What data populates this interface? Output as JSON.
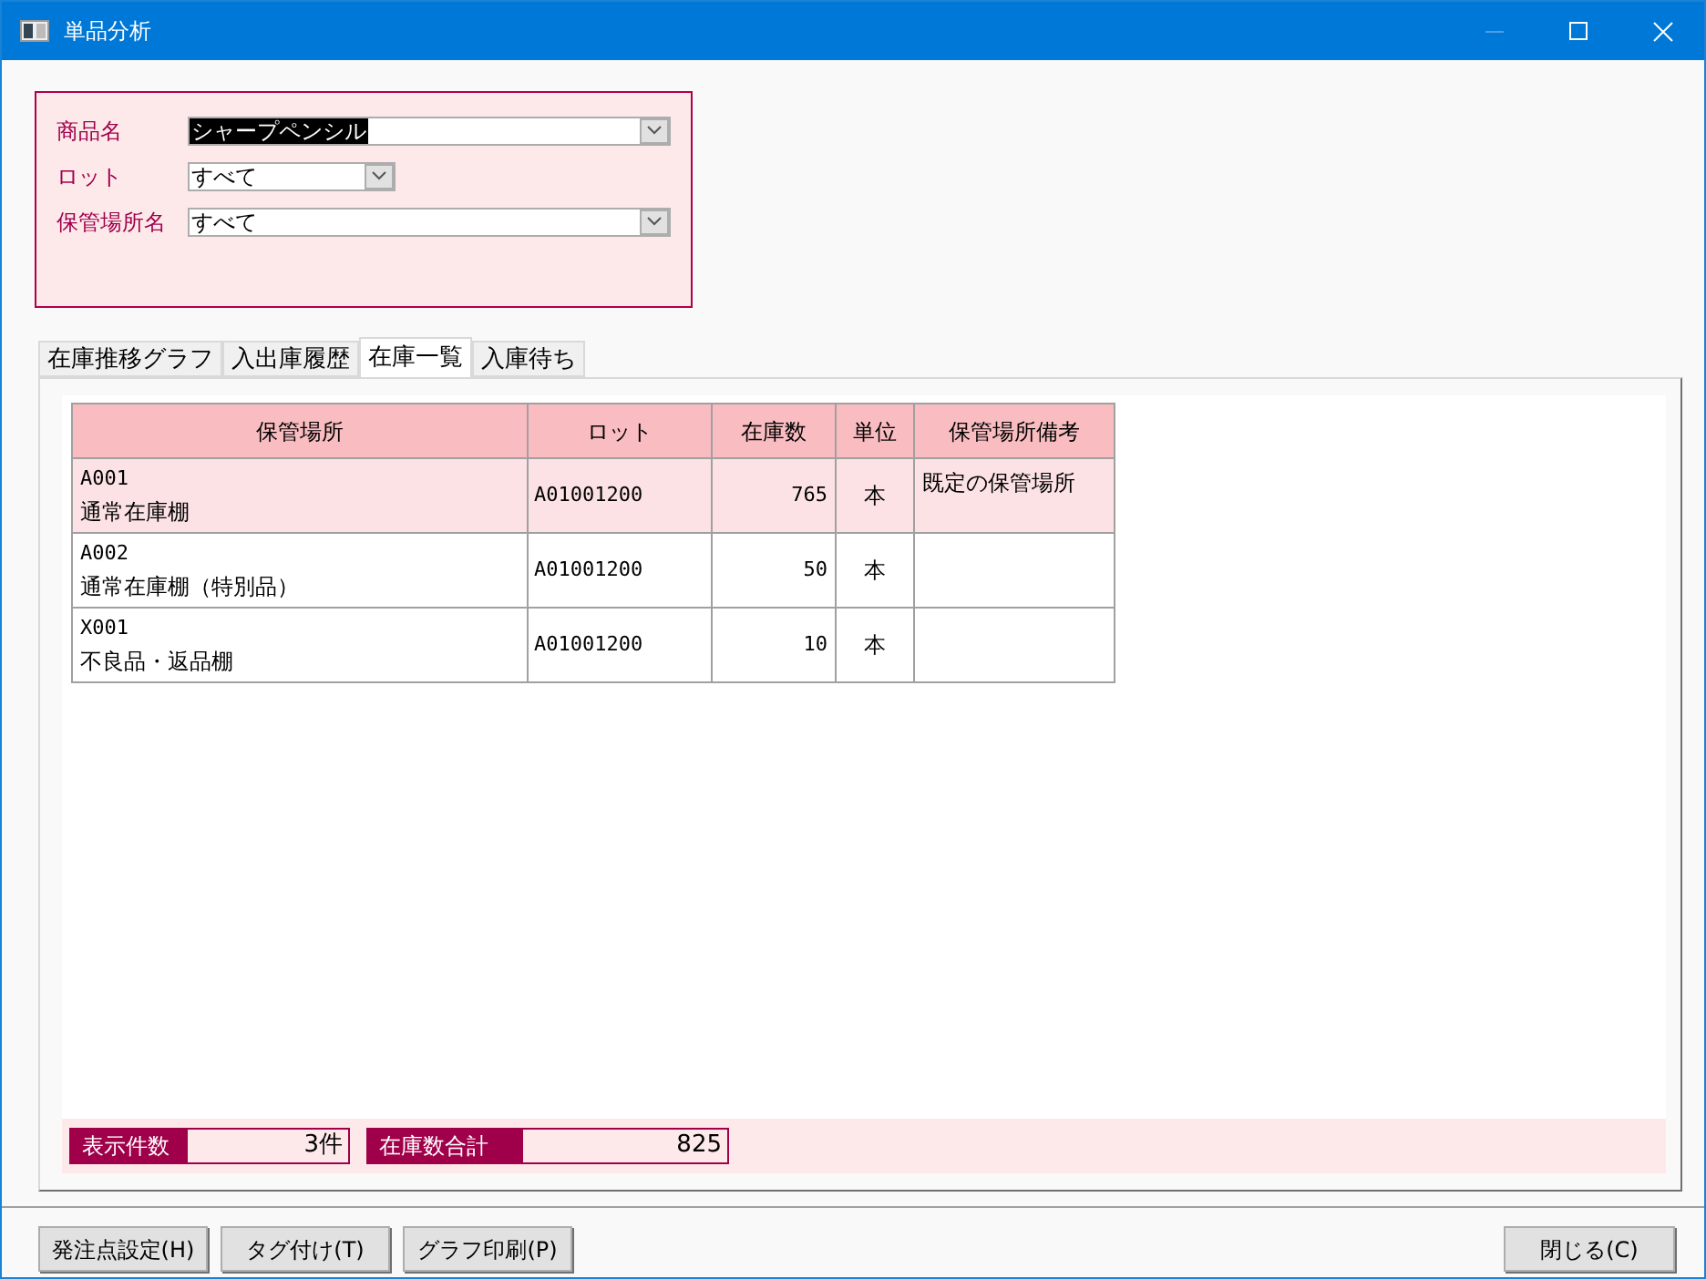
{
  "window": {
    "title": "単品分析",
    "minimize_disabled": true
  },
  "filters": [
    {
      "label": "商品名",
      "value": "シャープペンシル",
      "highlighted": true,
      "kind": "wide"
    },
    {
      "label": "ロット",
      "value": "すべて",
      "highlighted": false,
      "kind": "narrow"
    },
    {
      "label": "保管場所名",
      "value": "すべて",
      "highlighted": false,
      "kind": "wide"
    }
  ],
  "tabs": [
    {
      "label": "在庫推移グラフ",
      "selected": false
    },
    {
      "label": "入出庫履歴",
      "selected": false
    },
    {
      "label": "在庫一覧",
      "selected": true
    },
    {
      "label": "入庫待ち",
      "selected": false
    }
  ],
  "table": {
    "columns": [
      "保管場所",
      "ロット",
      "在庫数",
      "単位",
      "保管場所備考"
    ],
    "rows": [
      {
        "selected": true,
        "location_code": "A001",
        "location_name": "通常在庫棚",
        "lot": "A01001200",
        "quantity": "765",
        "unit": "本",
        "note": "既定の保管場所"
      },
      {
        "selected": false,
        "location_code": "A002",
        "location_name": "通常在庫棚（特別品）",
        "lot": "A01001200",
        "quantity": "50",
        "unit": "本"
      },
      {
        "selected": false,
        "location_code": "X001",
        "location_name": "不良品・返品棚",
        "lot": "A01001200",
        "quantity": "10",
        "unit": "本"
      }
    ]
  },
  "summary": [
    {
      "label": "表示件数",
      "value": "3件"
    },
    {
      "label": "在庫数合計",
      "value": "825"
    }
  ],
  "buttons_left": [
    "発注点設定(H)",
    "タグ付け(T)",
    "グラフ印刷(P)"
  ],
  "buttons_right": [
    "閉じる(C)"
  ]
}
